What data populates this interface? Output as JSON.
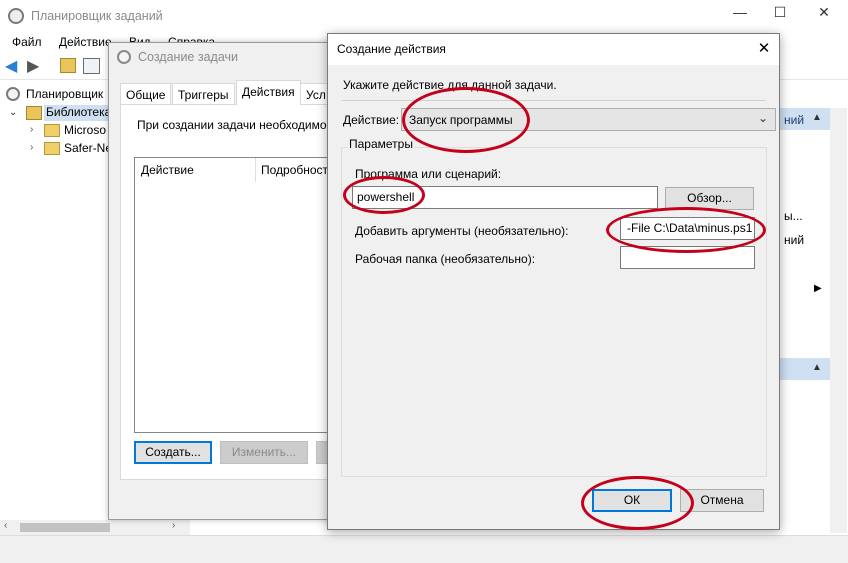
{
  "main": {
    "title": "Планировщик заданий",
    "menu": [
      "Файл",
      "Действие",
      "Вид",
      "Справка"
    ],
    "tree": {
      "root": "Планировщик",
      "library": "Библиотека",
      "children": [
        "Microso",
        "Safer-Ne"
      ]
    },
    "right_panel": {
      "item1": "ний",
      "item2": "ы...",
      "item3": "ний"
    }
  },
  "create_task": {
    "title": "Создание задачи",
    "tabs": [
      "Общие",
      "Триггеры",
      "Действия",
      "Усл"
    ],
    "active_tab": "Действия",
    "description": "При создании задачи необходимо",
    "columns": [
      "Действие",
      "Подробност"
    ],
    "buttons": {
      "create": "Создать...",
      "edit": "Изменить..."
    }
  },
  "create_action": {
    "title": "Создание действия",
    "instruction": "Укажите действие для данной задачи.",
    "action_label": "Действие:",
    "action_value": "Запуск программы",
    "params_label": "Параметры",
    "program_label": "Программа или сценарий:",
    "program_value": "powershell",
    "browse_label": "Обзор...",
    "args_label": "Добавить аргументы (необязательно):",
    "args_value": "-File C:\\Data\\minus.ps1",
    "workdir_label": "Рабочая папка (необязательно):",
    "workdir_value": "",
    "ok_label": "ОК",
    "cancel_label": "Отмена"
  },
  "colors": {
    "annotation": "#c4001a",
    "accent": "#0078d7",
    "selection": "#cfe0f2"
  }
}
